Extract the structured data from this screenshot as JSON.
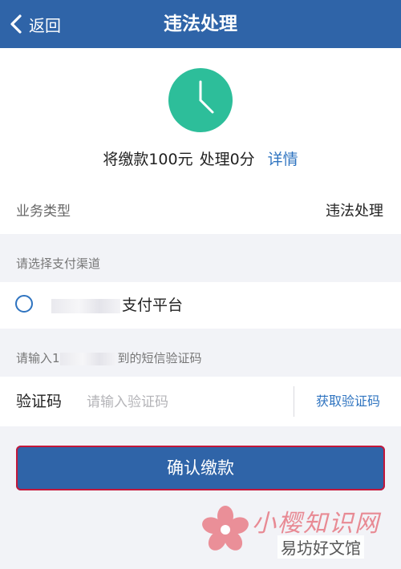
{
  "header": {
    "back_label": "返回",
    "title": "违法处理",
    "color": "#2f64a8"
  },
  "status": {
    "icon": "clock-icon",
    "icon_color": "#2dbe9a",
    "fine_text": "将缴款100元",
    "points_text": "处理0分",
    "detail_link": "详情"
  },
  "business": {
    "label": "业务类型",
    "value": "违法处理"
  },
  "payment": {
    "section_hint": "请选择支付渠道",
    "channel_label": "支付平台",
    "channel_selected": false
  },
  "sms": {
    "hint_prefix": "请输入1",
    "hint_suffix": "到的短信验证码",
    "code_label": "验证码",
    "code_placeholder": "请输入验证码",
    "code_value": "",
    "get_code_button": "获取验证码"
  },
  "confirm_button": "确认缴款",
  "watermark": {
    "main": "小樱知识网",
    "sub": "易坊好文馆"
  }
}
